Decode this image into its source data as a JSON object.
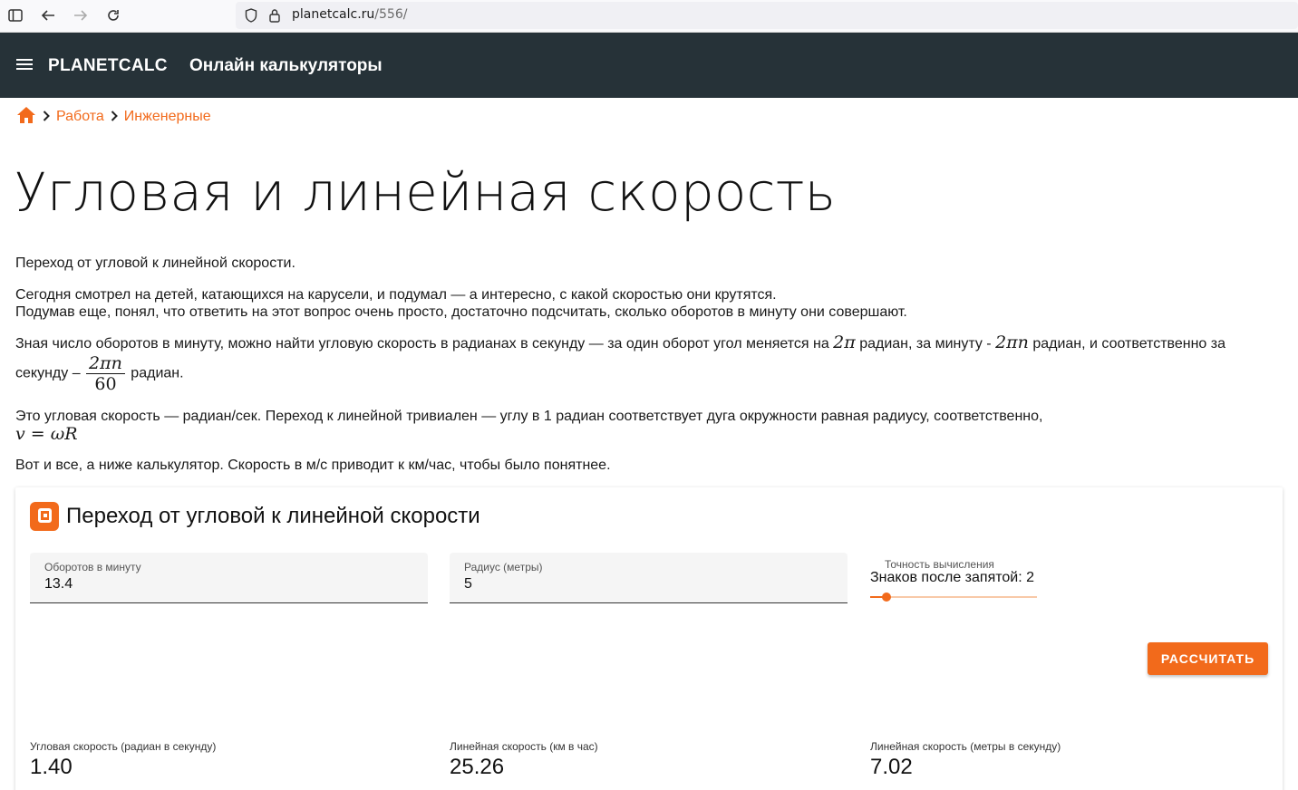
{
  "browser": {
    "url_host": "planetcalc.ru",
    "url_path": "/556/"
  },
  "appbar": {
    "brand": "PLANETCALC",
    "subtitle": "Онлайн калькуляторы"
  },
  "breadcrumb": [
    {
      "label": "Работа"
    },
    {
      "label": "Инженерные"
    }
  ],
  "page": {
    "title": "Угловая и линейная скорость",
    "p1": "Переход от угловой к линейной скорости.",
    "p2_line1": "Сегодня смотрел на детей, катающихся на карусели, и подумал — а интересно, с какой скоростью они крутятся.",
    "p2_line2": "Подумав еще, понял, что ответить на этот вопрос очень просто, достаточно подсчитать, сколько оборотов в минуту они совершают.",
    "p3_a": "Зная число оборотов в минуту, можно найти угловую скорость в радианах в секунду — за один оборот угол меняется на ",
    "p3_math1": "2π",
    "p3_b": " радиан, за минуту - ",
    "p3_math2": "2πn",
    "p3_c": " радиан, и соответственно за",
    "p3_d": "секунду – ",
    "p3_frac_num": "2πn",
    "p3_frac_den": "60",
    "p3_e": " радиан.",
    "p4": "Это угловая скорость — радиан/сек. Переход к линейной тривиален — углу в 1 радиан соответствует дуга окружности равная радиусу, соответственно,",
    "p4_math": "v = ωR",
    "p5": "Вот и все, а ниже калькулятор. Скорость в м/с приводит к км/час, чтобы было понятнее."
  },
  "calculator": {
    "title": "Переход от угловой к линейной скорости",
    "rpm_label": "Оборотов в минуту",
    "rpm_value": "13.4",
    "radius_label": "Радиус (метры)",
    "radius_value": "5",
    "precision_label": "Точность вычисления",
    "precision_value_text": "Знаков после запятой: 2",
    "precision_slider_fraction": 0.1,
    "button_label": "РАССЧИТАТЬ",
    "results": [
      {
        "label": "Угловая скорость (радиан в секунду)",
        "value": "1.40"
      },
      {
        "label": "Линейная скорость (км в час)",
        "value": "25.26"
      },
      {
        "label": "Линейная скорость (метры в секунду)",
        "value": "7.02"
      }
    ]
  },
  "colors": {
    "accent": "#f26a1b",
    "appbar": "#263238"
  },
  "icons": [
    "sidebar-icon",
    "back-icon",
    "forward-icon",
    "reload-icon",
    "shield-icon",
    "lock-icon",
    "menu-icon",
    "home-icon",
    "chevron-right-icon",
    "planetcalc-logo-icon"
  ]
}
